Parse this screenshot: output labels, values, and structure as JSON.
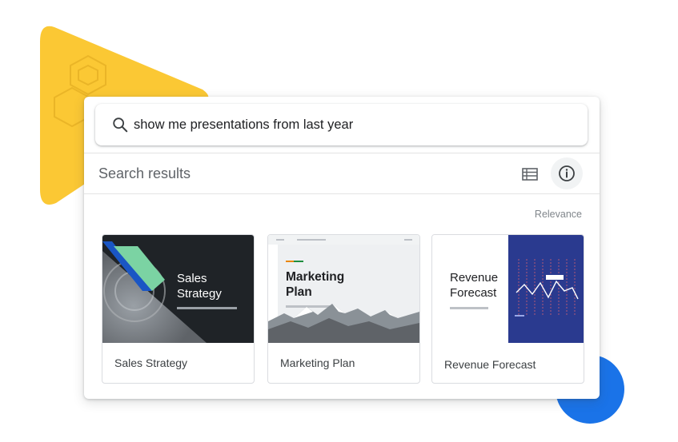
{
  "search": {
    "query": "show me presentations from last year",
    "icon": "search-icon"
  },
  "results": {
    "title": "Search results",
    "sort_label": "Relevance",
    "view_icon": "list-view-icon",
    "info_icon": "info-icon"
  },
  "tiles": [
    {
      "thumb_title": "Sales\nStrategy",
      "label": "Sales Strategy"
    },
    {
      "thumb_title": "Marketing\nPlan",
      "label": "Marketing Plan"
    },
    {
      "thumb_title": "Revenue\nForecast",
      "label": "Revenue Forecast"
    }
  ],
  "colors": {
    "accent_blue": "#1a73e8",
    "deco_yellow": "#fbc834",
    "dark_slide": "#1f2327",
    "navy_slide": "#2a3a8f",
    "mint": "#7bd3a3"
  }
}
